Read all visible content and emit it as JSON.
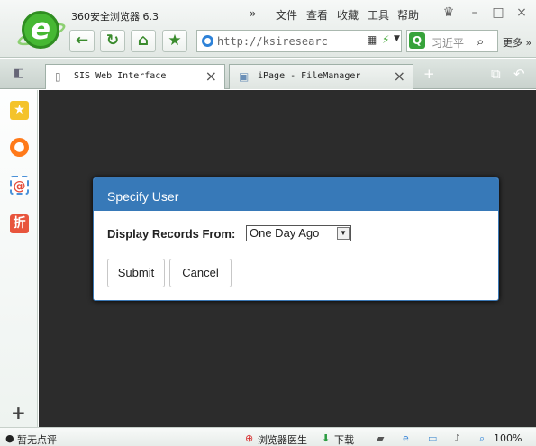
{
  "window": {
    "app_title": "360安全浏览器 6.3",
    "menus": [
      "»",
      "文件",
      "查看",
      "收藏",
      "工具",
      "帮助"
    ],
    "url": "http://ksiresearc",
    "search_placeholder": "习近平",
    "more": "更多 »"
  },
  "tabs": [
    {
      "label": "SIS Web Interface",
      "active": true
    },
    {
      "label": "iPage - FileManager",
      "active": false
    }
  ],
  "dialog": {
    "title": "Specify User",
    "field_label": "Display Records From:",
    "selected_option": "One Day Ago",
    "submit": "Submit",
    "cancel": "Cancel"
  },
  "status": {
    "left": "暂无点评",
    "doctor": "浏览器医生",
    "download": "下载",
    "zoom": "100%"
  },
  "colors": {
    "dialog_header": "#3779b8",
    "page_background": "#2c2c2c",
    "brand_green": "#46b833"
  }
}
